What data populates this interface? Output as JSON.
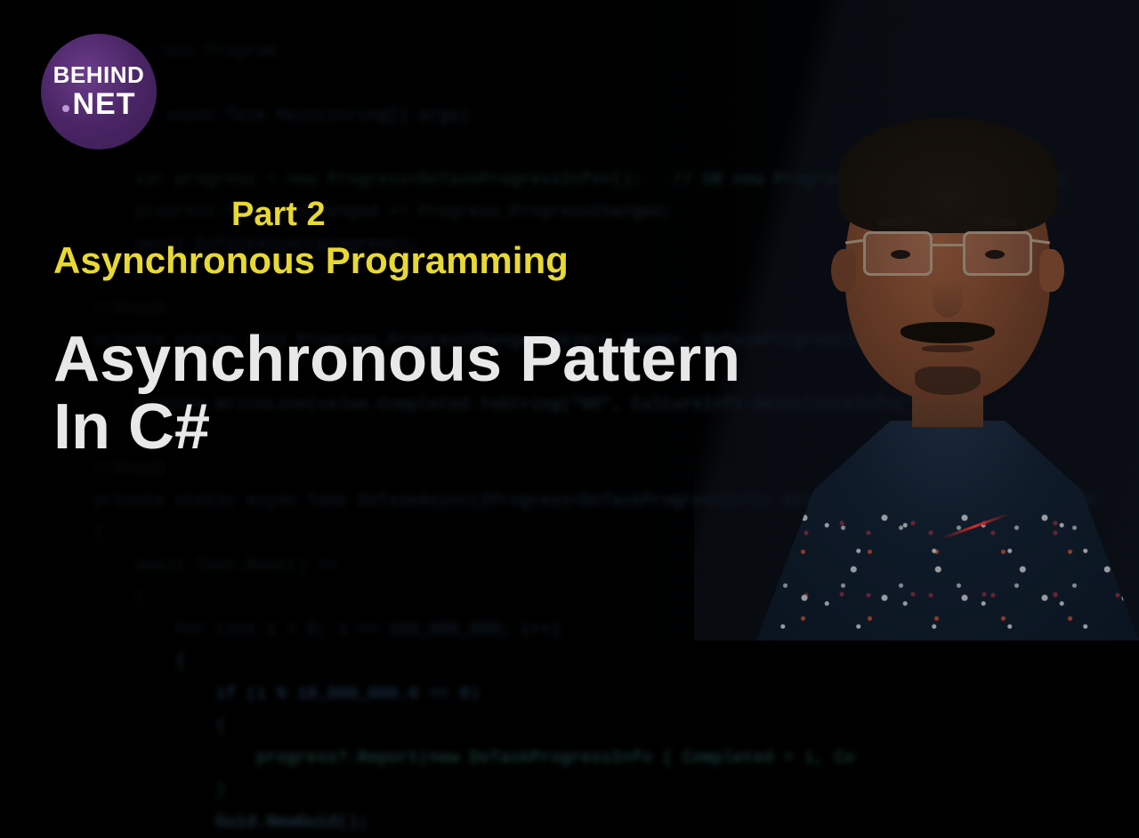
{
  "logo": {
    "line1": "BEHIND",
    "line2": "NET"
  },
  "thumbnail": {
    "part_label": "Part 2",
    "subtitle": "Asynchronous Programming",
    "title_line1": "Asynchronous Pattern",
    "title_line2": "In C#"
  },
  "background_code": {
    "lines": [
      "internal class Program",
      "{",
      "    static async Task Main(string[] args)",
      "    {",
      "        var progress = new Progress<DoTaskProgressInfo>();   // OR new Progress<DoTaskProgressInfo>(",
      "        progress.ProgressChanged += Progress_ProgressChanged;",
      "",
      "        await DoTaskAsync(progress);",
      "    }",
      "",
      "    //Step3",
      "    private static void Progress_ProgressChanged(object sender, DoTaskProgressInfo value)",
      "    {",
      "        Console.WriteLine(value.Completed.ToString(\"N0\", CultureInfo.GetCultureInfo(\"",
      "    }",
      "",
      "    //Step2",
      "    private static async Task DoTaskAsync(IProgress<DoTaskProgressInfo> progress = default)   // IProgr",
      "    {",
      "        await Task.Run(() =>",
      "        {",
      "            for (int i = 0; i <= 100_000_000; i++)",
      "            {",
      "                if (i % 10_000_000.0 == 0)",
      "                {",
      "                    progress?.Report(new DoTaskProgressInfo { Completed = i, Co",
      "                }",
      "",
      "                Guid.NewGuid();"
    ]
  }
}
